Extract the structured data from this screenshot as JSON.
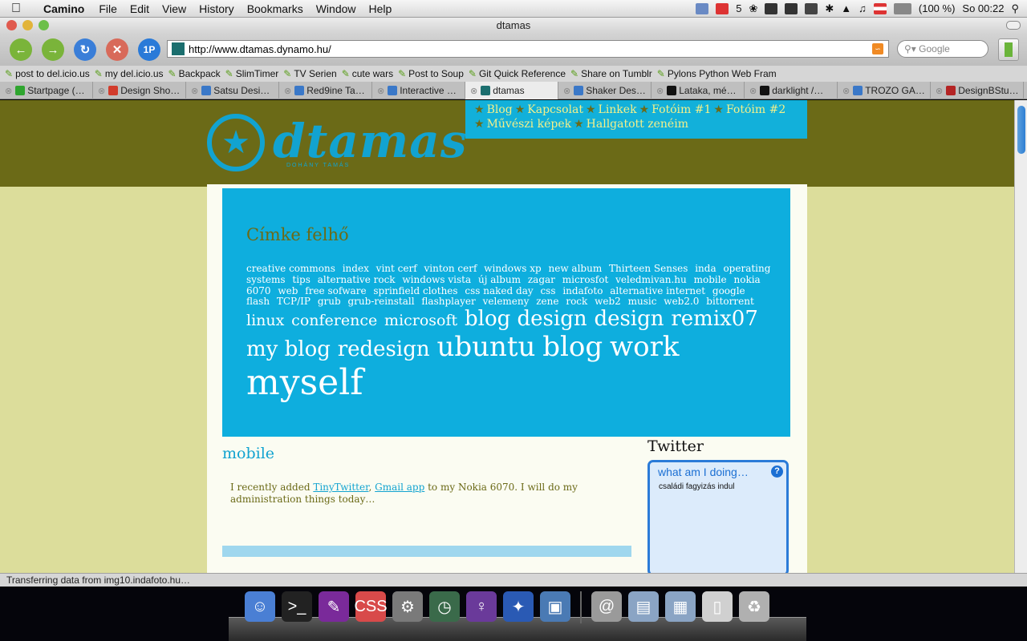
{
  "menubar": {
    "app": "Camino",
    "items": [
      "File",
      "Edit",
      "View",
      "History",
      "Bookmarks",
      "Window",
      "Help"
    ],
    "mail_count": "5",
    "battery": "(100 %)",
    "clock": "So 00:22"
  },
  "window": {
    "title": "dtamas"
  },
  "toolbar": {
    "url": "http://www.dtamas.dynamo.hu/",
    "search_placeholder": "Google",
    "onepassword_label": "1P"
  },
  "bookmarks": [
    "post to del.icio.us",
    "my del.icio.us",
    "Backpack",
    "SlimTimer",
    "TV Serien",
    "cute wars",
    "Post to Soup",
    "Git Quick Reference",
    "Share on Tumblr",
    "Pylons Python Web Fram"
  ],
  "tabs": [
    {
      "label": "Startpage (…",
      "color": "#2fa52f"
    },
    {
      "label": "Design Sho…",
      "color": "#d23c2c"
    },
    {
      "label": "Satsu Desi…",
      "color": "#3a78c8"
    },
    {
      "label": "Red9ine Ta…",
      "color": "#3a78c8"
    },
    {
      "label": "Interactive …",
      "color": "#3a78c8"
    },
    {
      "label": "dtamas",
      "color": "#1b6e6e",
      "active": true
    },
    {
      "label": "Shaker Des…",
      "color": "#3a78c8"
    },
    {
      "label": "Lataka, mé…",
      "color": "#111111"
    },
    {
      "label": "darklight /…",
      "color": "#111111"
    },
    {
      "label": "TROZO GA…",
      "color": "#3a78c8"
    },
    {
      "label": "DesignBStu…",
      "color": "#b42424"
    }
  ],
  "site": {
    "logo_text": "dtamas",
    "logo_sub": "DOHÁNY TAMÁS",
    "nav": [
      "Blog",
      "Kapcsolat",
      "Linkek",
      "Fotóim #1",
      "Fotóim #2",
      "Művészi képek",
      "Hallgatott zenéim"
    ],
    "cloud_title": "Címke felhő",
    "tags": [
      {
        "t": "creative commons",
        "s": 12
      },
      {
        "t": "index",
        "s": 12
      },
      {
        "t": "vint cerf",
        "s": 12
      },
      {
        "t": "vinton cerf",
        "s": 12
      },
      {
        "t": "windows xp",
        "s": 12
      },
      {
        "t": "new album",
        "s": 12
      },
      {
        "t": "Thirteen Senses",
        "s": 12
      },
      {
        "t": "inda",
        "s": 12
      },
      {
        "t": "operating systems",
        "s": 12
      },
      {
        "t": "tips",
        "s": 12
      },
      {
        "t": "alternative rock",
        "s": 12
      },
      {
        "t": "windows vista",
        "s": 12
      },
      {
        "t": "új album",
        "s": 12
      },
      {
        "t": "zagar",
        "s": 12
      },
      {
        "t": "microsfot",
        "s": 12
      },
      {
        "t": "veledmivan.hu",
        "s": 12
      },
      {
        "t": "mobile",
        "s": 12
      },
      {
        "t": "nokia 6070",
        "s": 12
      },
      {
        "t": "web",
        "s": 12
      },
      {
        "t": "free sofware",
        "s": 12
      },
      {
        "t": "sprinfield clothes",
        "s": 12
      },
      {
        "t": "css naked day",
        "s": 12
      },
      {
        "t": "css",
        "s": 12
      },
      {
        "t": "indafoto",
        "s": 12
      },
      {
        "t": "alternative internet",
        "s": 12
      },
      {
        "t": "google",
        "s": 12
      },
      {
        "t": "flash",
        "s": 12
      },
      {
        "t": "TCP/IP",
        "s": 12
      },
      {
        "t": "grub",
        "s": 12
      },
      {
        "t": "grub-reinstall",
        "s": 12
      },
      {
        "t": "flashplayer",
        "s": 12
      },
      {
        "t": "velemeny",
        "s": 12
      },
      {
        "t": "zene",
        "s": 12
      },
      {
        "t": "rock",
        "s": 12
      },
      {
        "t": "web2",
        "s": 12
      },
      {
        "t": "music",
        "s": 12
      },
      {
        "t": "web2.0",
        "s": 12
      },
      {
        "t": "bittorrent",
        "s": 12
      },
      {
        "t": "linux",
        "s": 19
      },
      {
        "t": "conference",
        "s": 19
      },
      {
        "t": "microsoft",
        "s": 19
      },
      {
        "t": "blog design",
        "s": 26
      },
      {
        "t": "design",
        "s": 26
      },
      {
        "t": "remix07",
        "s": 26
      },
      {
        "t": "my blog",
        "s": 26
      },
      {
        "t": "redesign",
        "s": 26
      },
      {
        "t": "ubuntu",
        "s": 34
      },
      {
        "t": "blog",
        "s": 34
      },
      {
        "t": "work",
        "s": 34
      },
      {
        "t": "myself",
        "s": 44
      }
    ],
    "post_title": "mobile",
    "post_pre": "I recently added ",
    "post_link1": "TinyTwitter",
    "post_sep": ", ",
    "post_link2": "Gmail app",
    "post_post": " to my Nokia 6070. I will do my administration things today…",
    "twitter_title": "Twitter",
    "twitter_head": "what am I doing…",
    "twitter_msg": "családi fagyizás indul"
  },
  "status": "Transferring data from img10.indafoto.hu…",
  "dock": [
    {
      "name": "finder-icon",
      "color": "#4a7fd4",
      "glyph": "☺"
    },
    {
      "name": "terminal-icon",
      "color": "#222222",
      "glyph": ">_"
    },
    {
      "name": "textmate-icon",
      "color": "#7a2a9a",
      "glyph": "✎"
    },
    {
      "name": "cssedit-icon",
      "color": "#d84a4a",
      "glyph": "CSS"
    },
    {
      "name": "system-preferences-icon",
      "color": "#7a7a7a",
      "glyph": "⚙"
    },
    {
      "name": "time-machine-icon",
      "color": "#3a6a4a",
      "glyph": "◷"
    },
    {
      "name": "adium-icon",
      "color": "#6a3a9a",
      "glyph": "♀"
    },
    {
      "name": "camino-icon",
      "color": "#2a5ab4",
      "glyph": "✦"
    },
    {
      "name": "iphoto-icon",
      "color": "#4a7ab4",
      "glyph": "▣"
    },
    {
      "name": "mail-icon",
      "color": "#9a9a9a",
      "glyph": "@"
    },
    {
      "name": "documents-folder-icon",
      "color": "#8aa4c4",
      "glyph": "▤"
    },
    {
      "name": "movies-folder-icon",
      "color": "#8aa4c4",
      "glyph": "▦"
    },
    {
      "name": "notes-icon",
      "color": "#d0d0d0",
      "glyph": "▯"
    },
    {
      "name": "trash-icon",
      "color": "#b0b0b0",
      "glyph": "♻"
    }
  ]
}
